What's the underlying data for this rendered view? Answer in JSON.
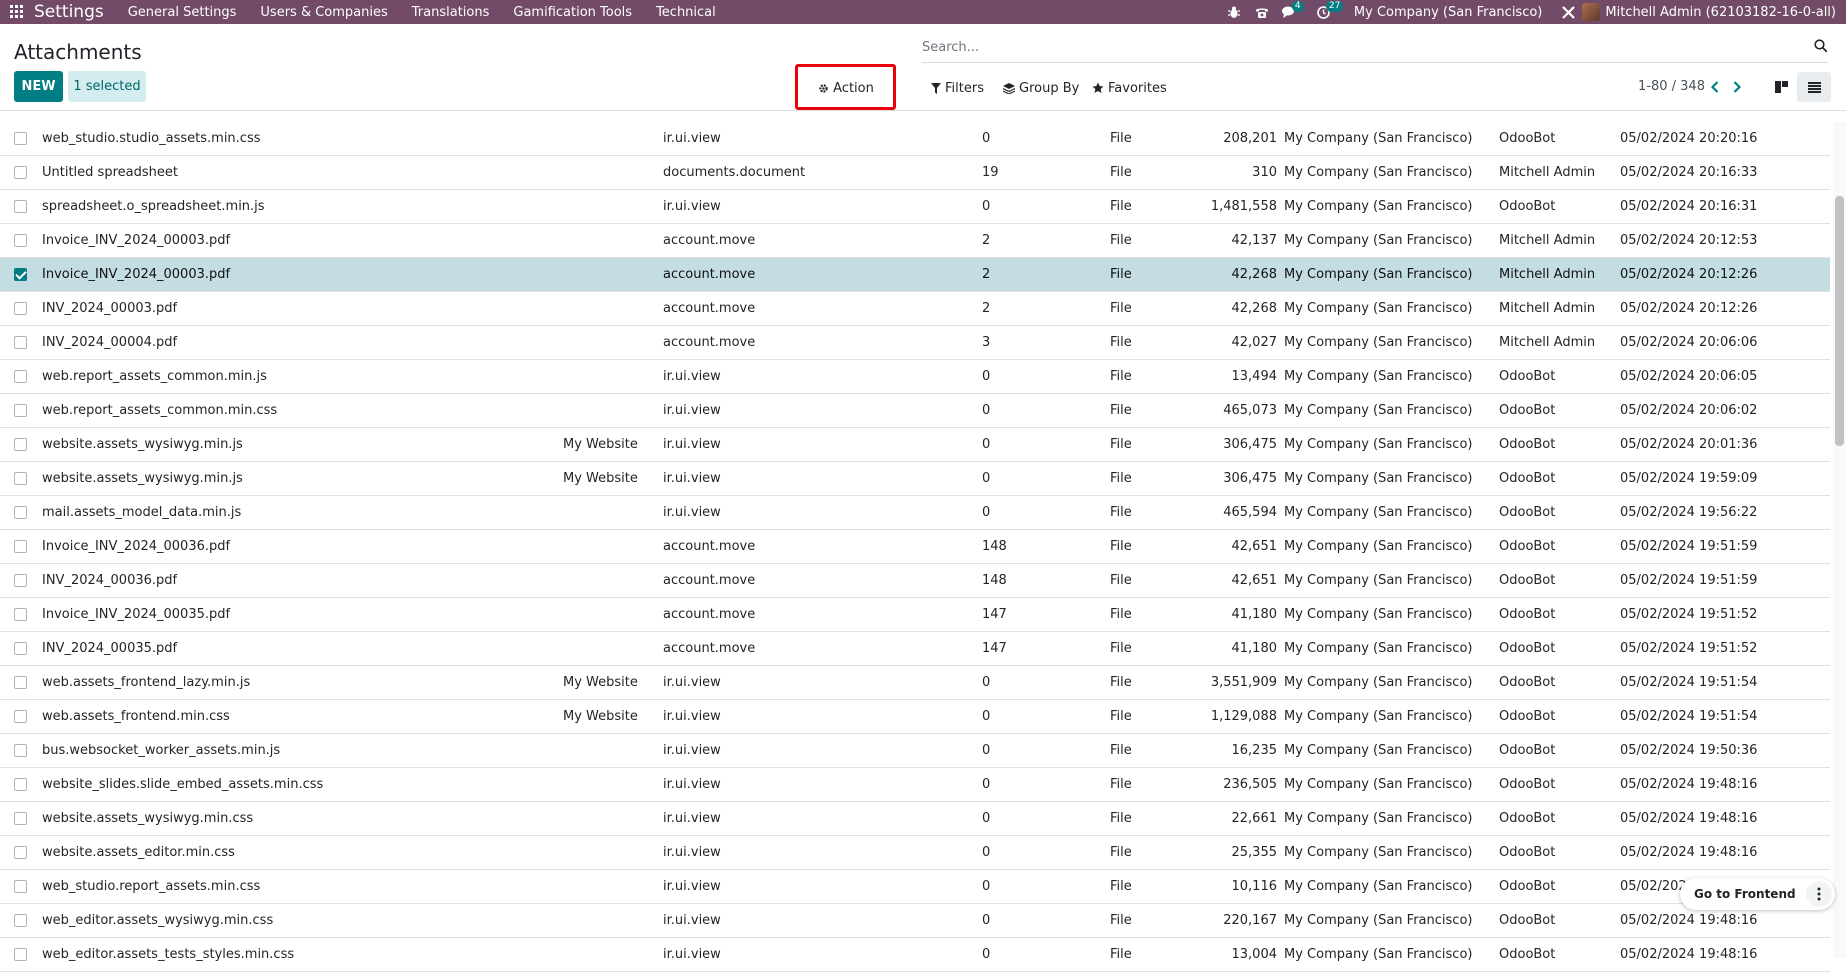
{
  "navbar": {
    "app_name": "Settings",
    "menus": [
      "General Settings",
      "Users & Companies",
      "Translations",
      "Gamification Tools",
      "Technical"
    ],
    "messages_badge": "4",
    "activities_badge": "27",
    "company": "My Company (San Francisco)",
    "user": "Mitchell Admin (62103182-16-0-all)"
  },
  "control_panel": {
    "title": "Attachments",
    "new_label": "NEW",
    "selected_label": "1 selected",
    "action_label": "Action",
    "search_placeholder": "Search...",
    "filters_label": "Filters",
    "group_by_label": "Group By",
    "favorites_label": "Favorites",
    "pager": "1-80 / 348"
  },
  "rows": [
    {
      "name": "web_studio.studio_assets.min.css",
      "website": "",
      "model": "ir.ui.view",
      "res_id": "0",
      "type": "File",
      "size": "208,201",
      "company": "My Company (San Francisco)",
      "owner": "OdooBot",
      "date": "05/02/2024 20:20:16",
      "selected": false
    },
    {
      "name": "Untitled spreadsheet",
      "website": "",
      "model": "documents.document",
      "res_id": "19",
      "type": "File",
      "size": "310",
      "company": "My Company (San Francisco)",
      "owner": "Mitchell Admin",
      "date": "05/02/2024 20:16:33",
      "selected": false
    },
    {
      "name": "spreadsheet.o_spreadsheet.min.js",
      "website": "",
      "model": "ir.ui.view",
      "res_id": "0",
      "type": "File",
      "size": "1,481,558",
      "company": "My Company (San Francisco)",
      "owner": "OdooBot",
      "date": "05/02/2024 20:16:31",
      "selected": false
    },
    {
      "name": "Invoice_INV_2024_00003.pdf",
      "website": "",
      "model": "account.move",
      "res_id": "2",
      "type": "File",
      "size": "42,137",
      "company": "My Company (San Francisco)",
      "owner": "Mitchell Admin",
      "date": "05/02/2024 20:12:53",
      "selected": false
    },
    {
      "name": "Invoice_INV_2024_00003.pdf",
      "website": "",
      "model": "account.move",
      "res_id": "2",
      "type": "File",
      "size": "42,268",
      "company": "My Company (San Francisco)",
      "owner": "Mitchell Admin",
      "date": "05/02/2024 20:12:26",
      "selected": true
    },
    {
      "name": "INV_2024_00003.pdf",
      "website": "",
      "model": "account.move",
      "res_id": "2",
      "type": "File",
      "size": "42,268",
      "company": "My Company (San Francisco)",
      "owner": "Mitchell Admin",
      "date": "05/02/2024 20:12:26",
      "selected": false
    },
    {
      "name": "INV_2024_00004.pdf",
      "website": "",
      "model": "account.move",
      "res_id": "3",
      "type": "File",
      "size": "42,027",
      "company": "My Company (San Francisco)",
      "owner": "Mitchell Admin",
      "date": "05/02/2024 20:06:06",
      "selected": false
    },
    {
      "name": "web.report_assets_common.min.js",
      "website": "",
      "model": "ir.ui.view",
      "res_id": "0",
      "type": "File",
      "size": "13,494",
      "company": "My Company (San Francisco)",
      "owner": "OdooBot",
      "date": "05/02/2024 20:06:05",
      "selected": false
    },
    {
      "name": "web.report_assets_common.min.css",
      "website": "",
      "model": "ir.ui.view",
      "res_id": "0",
      "type": "File",
      "size": "465,073",
      "company": "My Company (San Francisco)",
      "owner": "OdooBot",
      "date": "05/02/2024 20:06:02",
      "selected": false
    },
    {
      "name": "website.assets_wysiwyg.min.js",
      "website": "My Website",
      "model": "ir.ui.view",
      "res_id": "0",
      "type": "File",
      "size": "306,475",
      "company": "My Company (San Francisco)",
      "owner": "OdooBot",
      "date": "05/02/2024 20:01:36",
      "selected": false
    },
    {
      "name": "website.assets_wysiwyg.min.js",
      "website": "My Website",
      "model": "ir.ui.view",
      "res_id": "0",
      "type": "File",
      "size": "306,475",
      "company": "My Company (San Francisco)",
      "owner": "OdooBot",
      "date": "05/02/2024 19:59:09",
      "selected": false
    },
    {
      "name": "mail.assets_model_data.min.js",
      "website": "",
      "model": "ir.ui.view",
      "res_id": "0",
      "type": "File",
      "size": "465,594",
      "company": "My Company (San Francisco)",
      "owner": "OdooBot",
      "date": "05/02/2024 19:56:22",
      "selected": false
    },
    {
      "name": "Invoice_INV_2024_00036.pdf",
      "website": "",
      "model": "account.move",
      "res_id": "148",
      "type": "File",
      "size": "42,651",
      "company": "My Company (San Francisco)",
      "owner": "OdooBot",
      "date": "05/02/2024 19:51:59",
      "selected": false
    },
    {
      "name": "INV_2024_00036.pdf",
      "website": "",
      "model": "account.move",
      "res_id": "148",
      "type": "File",
      "size": "42,651",
      "company": "My Company (San Francisco)",
      "owner": "OdooBot",
      "date": "05/02/2024 19:51:59",
      "selected": false
    },
    {
      "name": "Invoice_INV_2024_00035.pdf",
      "website": "",
      "model": "account.move",
      "res_id": "147",
      "type": "File",
      "size": "41,180",
      "company": "My Company (San Francisco)",
      "owner": "OdooBot",
      "date": "05/02/2024 19:51:52",
      "selected": false
    },
    {
      "name": "INV_2024_00035.pdf",
      "website": "",
      "model": "account.move",
      "res_id": "147",
      "type": "File",
      "size": "41,180",
      "company": "My Company (San Francisco)",
      "owner": "OdooBot",
      "date": "05/02/2024 19:51:52",
      "selected": false
    },
    {
      "name": "web.assets_frontend_lazy.min.js",
      "website": "My Website",
      "model": "ir.ui.view",
      "res_id": "0",
      "type": "File",
      "size": "3,551,909",
      "company": "My Company (San Francisco)",
      "owner": "OdooBot",
      "date": "05/02/2024 19:51:54",
      "selected": false
    },
    {
      "name": "web.assets_frontend.min.css",
      "website": "My Website",
      "model": "ir.ui.view",
      "res_id": "0",
      "type": "File",
      "size": "1,129,088",
      "company": "My Company (San Francisco)",
      "owner": "OdooBot",
      "date": "05/02/2024 19:51:54",
      "selected": false
    },
    {
      "name": "bus.websocket_worker_assets.min.js",
      "website": "",
      "model": "ir.ui.view",
      "res_id": "0",
      "type": "File",
      "size": "16,235",
      "company": "My Company (San Francisco)",
      "owner": "OdooBot",
      "date": "05/02/2024 19:50:36",
      "selected": false
    },
    {
      "name": "website_slides.slide_embed_assets.min.css",
      "website": "",
      "model": "ir.ui.view",
      "res_id": "0",
      "type": "File",
      "size": "236,505",
      "company": "My Company (San Francisco)",
      "owner": "OdooBot",
      "date": "05/02/2024 19:48:16",
      "selected": false
    },
    {
      "name": "website.assets_wysiwyg.min.css",
      "website": "",
      "model": "ir.ui.view",
      "res_id": "0",
      "type": "File",
      "size": "22,661",
      "company": "My Company (San Francisco)",
      "owner": "OdooBot",
      "date": "05/02/2024 19:48:16",
      "selected": false
    },
    {
      "name": "website.assets_editor.min.css",
      "website": "",
      "model": "ir.ui.view",
      "res_id": "0",
      "type": "File",
      "size": "25,355",
      "company": "My Company (San Francisco)",
      "owner": "OdooBot",
      "date": "05/02/2024 19:48:16",
      "selected": false
    },
    {
      "name": "web_studio.report_assets.min.css",
      "website": "",
      "model": "ir.ui.view",
      "res_id": "0",
      "type": "File",
      "size": "10,116",
      "company": "My Company (San Francisco)",
      "owner": "OdooBot",
      "date": "05/02/202",
      "selected": false
    },
    {
      "name": "web_editor.assets_wysiwyg.min.css",
      "website": "",
      "model": "ir.ui.view",
      "res_id": "0",
      "type": "File",
      "size": "220,167",
      "company": "My Company (San Francisco)",
      "owner": "OdooBot",
      "date": "05/02/2024 19:48:16",
      "selected": false
    },
    {
      "name": "web_editor.assets_tests_styles.min.css",
      "website": "",
      "model": "ir.ui.view",
      "res_id": "0",
      "type": "File",
      "size": "13,004",
      "company": "My Company (San Francisco)",
      "owner": "OdooBot",
      "date": "05/02/2024 19:48:16",
      "selected": false
    }
  ],
  "floating": {
    "go_to_frontend": "Go to Frontend"
  },
  "colors": {
    "navbar": "#714b67",
    "primary": "#017e84",
    "selected_row": "#c4dde3",
    "highlight_box": "#e8000d"
  }
}
